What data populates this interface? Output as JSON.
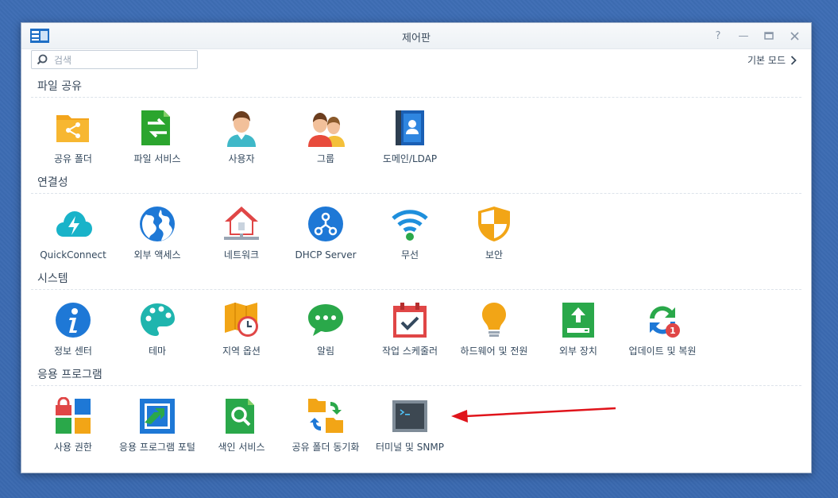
{
  "window": {
    "title": "제어판",
    "basic_mode_label": "기본 모드"
  },
  "search": {
    "placeholder": "검색"
  },
  "sections": {
    "file_sharing": {
      "title": "파일 공유",
      "items": [
        "공유 폴더",
        "파일 서비스",
        "사용자",
        "그룹",
        "도메인/LDAP"
      ]
    },
    "connectivity": {
      "title": "연결성",
      "items": [
        "QuickConnect",
        "외부 액세스",
        "네트워크",
        "DHCP Server",
        "무선",
        "보안"
      ]
    },
    "system": {
      "title": "시스템",
      "items": [
        "정보 센터",
        "테마",
        "지역 옵션",
        "알림",
        "작업 스케줄러",
        "하드웨어 및 전원",
        "외부 장치",
        "업데이트 및 복원"
      ],
      "update_badge": "1"
    },
    "applications": {
      "title": "응용 프로그램",
      "items": [
        "사용 권한",
        "응용 프로그램 포털",
        "색인 서비스",
        "공유 폴더 동기화",
        "터미널 및 SNMP"
      ]
    }
  },
  "colors": {
    "accent_arrow": "#e0141b",
    "window_bg": "#ffffff",
    "desktop_bg": "#3b6cb3"
  }
}
